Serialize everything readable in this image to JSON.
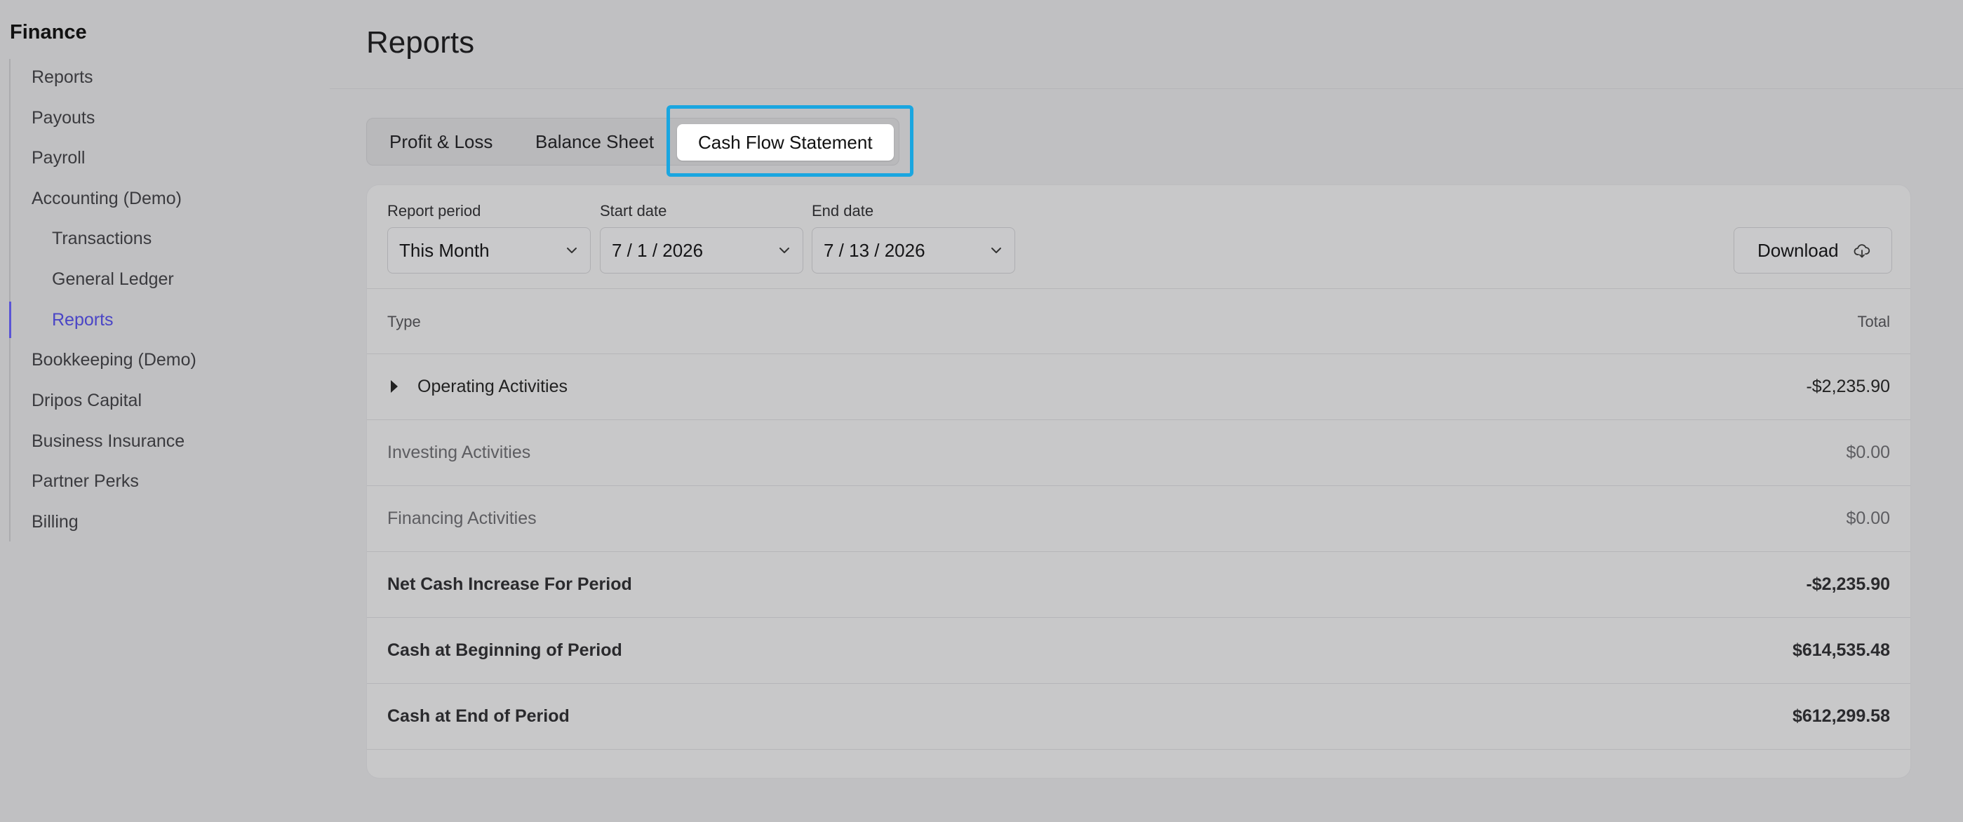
{
  "sidebar": {
    "title": "Finance",
    "items": [
      {
        "label": "Reports"
      },
      {
        "label": "Payouts"
      },
      {
        "label": "Payroll"
      },
      {
        "label": "Accounting (Demo)"
      },
      {
        "label": "Transactions"
      },
      {
        "label": "General Ledger"
      },
      {
        "label": "Reports",
        "active": true
      },
      {
        "label": "Bookkeeping (Demo)"
      },
      {
        "label": "Dripos Capital"
      },
      {
        "label": "Business Insurance"
      },
      {
        "label": "Partner Perks"
      },
      {
        "label": "Billing"
      }
    ]
  },
  "header": {
    "title": "Reports"
  },
  "tabs": [
    {
      "label": "Profit & Loss"
    },
    {
      "label": "Balance Sheet"
    },
    {
      "label": "Cash Flow Statement",
      "active": true
    }
  ],
  "filters": {
    "report_period": {
      "label": "Report period",
      "value": "This Month"
    },
    "start_date": {
      "label": "Start date",
      "value": "7 / 1 / 2026"
    },
    "end_date": {
      "label": "End date",
      "value": "7 / 13 / 2026"
    },
    "download_label": "Download"
  },
  "table": {
    "columns": {
      "type": "Type",
      "total": "Total"
    },
    "rows": [
      {
        "type": "Operating Activities",
        "total": "-$2,235.90"
      },
      {
        "type": "Investing Activities",
        "total": "$0.00"
      },
      {
        "type": "Financing Activities",
        "total": "$0.00"
      },
      {
        "type": "Net Cash Increase For Period",
        "total": "-$2,235.90"
      },
      {
        "type": "Cash at Beginning of Period",
        "total": "$614,535.48"
      },
      {
        "type": "Cash at End of Period",
        "total": "$612,299.58"
      }
    ]
  },
  "icons": {
    "chevron": "chevron-down-icon",
    "download": "cloud-download-icon",
    "expand": "caret-right-icon"
  },
  "colors": {
    "accent": "#4a45c6",
    "focus_ring": "#1aa6e0"
  }
}
